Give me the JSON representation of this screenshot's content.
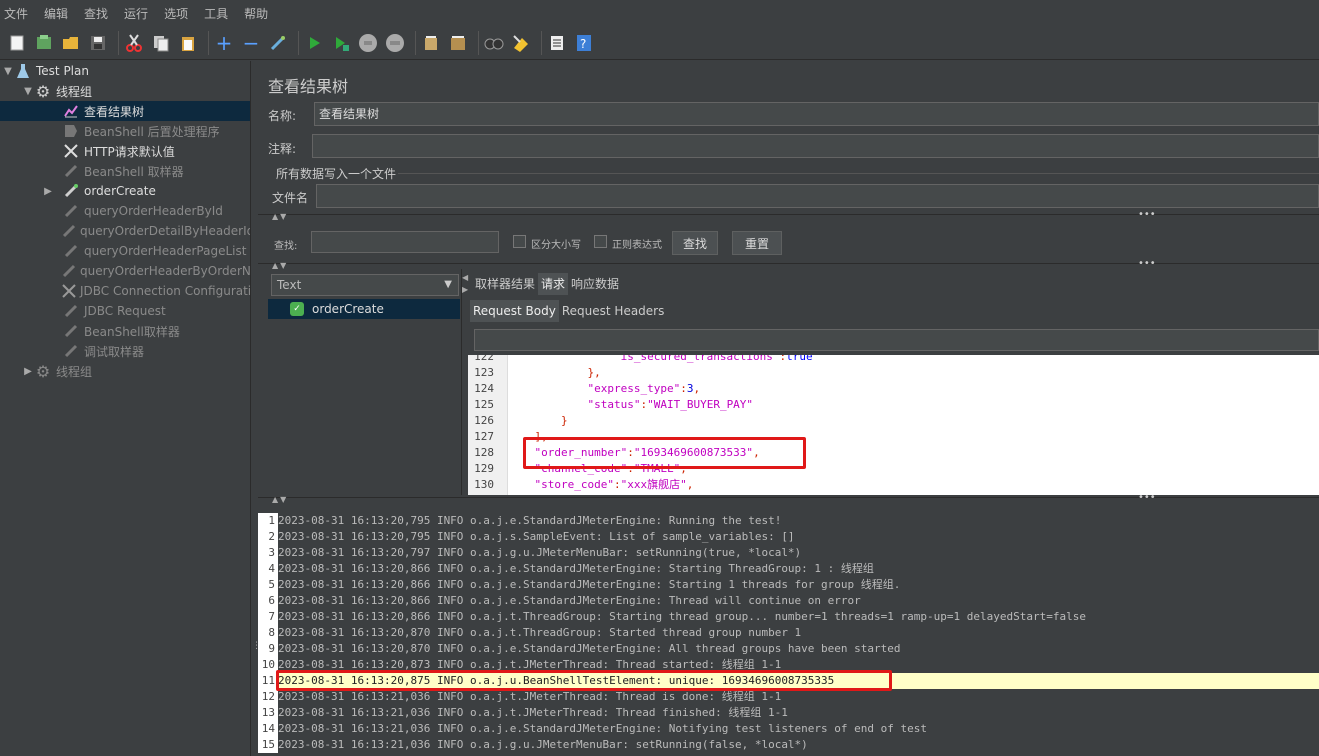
{
  "menu": [
    "文件",
    "编辑",
    "查找",
    "运行",
    "选项",
    "工具",
    "帮助"
  ],
  "toolbar_icons": [
    "new-icon",
    "templates-icon",
    "open-icon",
    "save-icon",
    "cut-icon",
    "copy-icon",
    "paste-icon",
    "expand-icon",
    "collapse-icon",
    "toggle-icon",
    "start-icon",
    "start-no-pause-icon",
    "stop-icon",
    "shutdown-icon",
    "clear-icon",
    "clear-all-icon",
    "search-icon",
    "reset-search-icon",
    "function-helper-icon",
    "help-icon"
  ],
  "tree": {
    "items": [
      {
        "label": "Test Plan"
      },
      {
        "label": "线程组"
      },
      {
        "label": "查看结果树"
      },
      {
        "label": "BeanShell 后置处理程序"
      },
      {
        "label": "HTTP请求默认值"
      },
      {
        "label": "BeanShell 取样器"
      },
      {
        "label": "orderCreate"
      },
      {
        "label": "queryOrderHeaderById"
      },
      {
        "label": "queryOrderDetailByHeaderId"
      },
      {
        "label": "queryOrderHeaderPageList"
      },
      {
        "label": "queryOrderHeaderByOrderNum"
      },
      {
        "label": "JDBC Connection Configuration"
      },
      {
        "label": "JDBC Request"
      },
      {
        "label": "BeanShell取样器"
      },
      {
        "label": "调试取样器"
      },
      {
        "label": "线程组"
      }
    ]
  },
  "panel": {
    "title": "查看结果树",
    "name_label": "名称:",
    "name_value": "查看结果树",
    "comment_label": "注释:",
    "comment_value": "",
    "file_group_label": "所有数据写入一个文件",
    "filename_label": "文件名",
    "filename_value": ""
  },
  "search": {
    "label": "查找:",
    "value": "",
    "case_label": "区分大小写",
    "regex_label": "正则表达式",
    "find_button": "查找",
    "reset_button": "重置"
  },
  "results": {
    "renderer": "Text",
    "items": [
      "orderCreate"
    ],
    "tabs": [
      "取样器结果",
      "请求",
      "响应数据"
    ],
    "active_tab": "请求",
    "subtabs": [
      "Request Body",
      "Request Headers"
    ],
    "active_subtab": "Request Body"
  },
  "code_lines": [
    {
      "n": "122",
      "indent": "                ",
      "text": "\"is_secured_transactions\":true"
    },
    {
      "n": "123",
      "indent": "            ",
      "text": "},"
    },
    {
      "n": "124",
      "indent": "            ",
      "text": "\"express_type\":3,"
    },
    {
      "n": "125",
      "indent": "            ",
      "text": "\"status\":\"WAIT_BUYER_PAY\""
    },
    {
      "n": "126",
      "indent": "        ",
      "text": "}"
    },
    {
      "n": "127",
      "indent": "    ",
      "text": "],"
    },
    {
      "n": "128",
      "indent": "    ",
      "text": "\"order_number\":\"1693469600873533\","
    },
    {
      "n": "129",
      "indent": "    ",
      "text": "\"channel_code\":\"TMALL\","
    },
    {
      "n": "130",
      "indent": "    ",
      "text": "\"store_code\":\"xxx旗舰店\","
    }
  ],
  "log_lines": [
    {
      "n": "1",
      "text": "2023-08-31 16:13:20,795 INFO o.a.j.e.StandardJMeterEngine: Running the test!"
    },
    {
      "n": "2",
      "text": "2023-08-31 16:13:20,795 INFO o.a.j.s.SampleEvent: List of sample_variables: []"
    },
    {
      "n": "3",
      "text": "2023-08-31 16:13:20,797 INFO o.a.j.g.u.JMeterMenuBar: setRunning(true, *local*)"
    },
    {
      "n": "4",
      "text": "2023-08-31 16:13:20,866 INFO o.a.j.e.StandardJMeterEngine: Starting ThreadGroup: 1 : 线程组"
    },
    {
      "n": "5",
      "text": "2023-08-31 16:13:20,866 INFO o.a.j.e.StandardJMeterEngine: Starting 1 threads for group 线程组."
    },
    {
      "n": "6",
      "text": "2023-08-31 16:13:20,866 INFO o.a.j.e.StandardJMeterEngine: Thread will continue on error"
    },
    {
      "n": "7",
      "text": "2023-08-31 16:13:20,866 INFO o.a.j.t.ThreadGroup: Starting thread group... number=1 threads=1 ramp-up=1 delayedStart=false"
    },
    {
      "n": "8",
      "text": "2023-08-31 16:13:20,870 INFO o.a.j.t.ThreadGroup: Started thread group number 1"
    },
    {
      "n": "9",
      "text": "2023-08-31 16:13:20,870 INFO o.a.j.e.StandardJMeterEngine: All thread groups have been started"
    },
    {
      "n": "10",
      "text": "2023-08-31 16:13:20,873 INFO o.a.j.t.JMeterThread: Thread started: 线程组 1-1"
    },
    {
      "n": "11",
      "text": "2023-08-31 16:13:20,875 INFO o.a.j.u.BeanShellTestElement: unique: 16934696008735335"
    },
    {
      "n": "12",
      "text": "2023-08-31 16:13:21,036 INFO o.a.j.t.JMeterThread: Thread is done: 线程组 1-1"
    },
    {
      "n": "13",
      "text": "2023-08-31 16:13:21,036 INFO o.a.j.t.JMeterThread: Thread finished: 线程组 1-1"
    },
    {
      "n": "14",
      "text": "2023-08-31 16:13:21,036 INFO o.a.j.e.StandardJMeterEngine: Notifying test listeners of end of test"
    },
    {
      "n": "15",
      "text": "2023-08-31 16:13:21,036 INFO o.a.j.g.u.JMeterMenuBar: setRunning(false, *local*)"
    }
  ],
  "highlighted_log_line": "11",
  "colors": {
    "bg": "#3c3f41",
    "selected": "#0d293e",
    "annotation_red": "#e01818",
    "highlight": "#ffffc8"
  }
}
